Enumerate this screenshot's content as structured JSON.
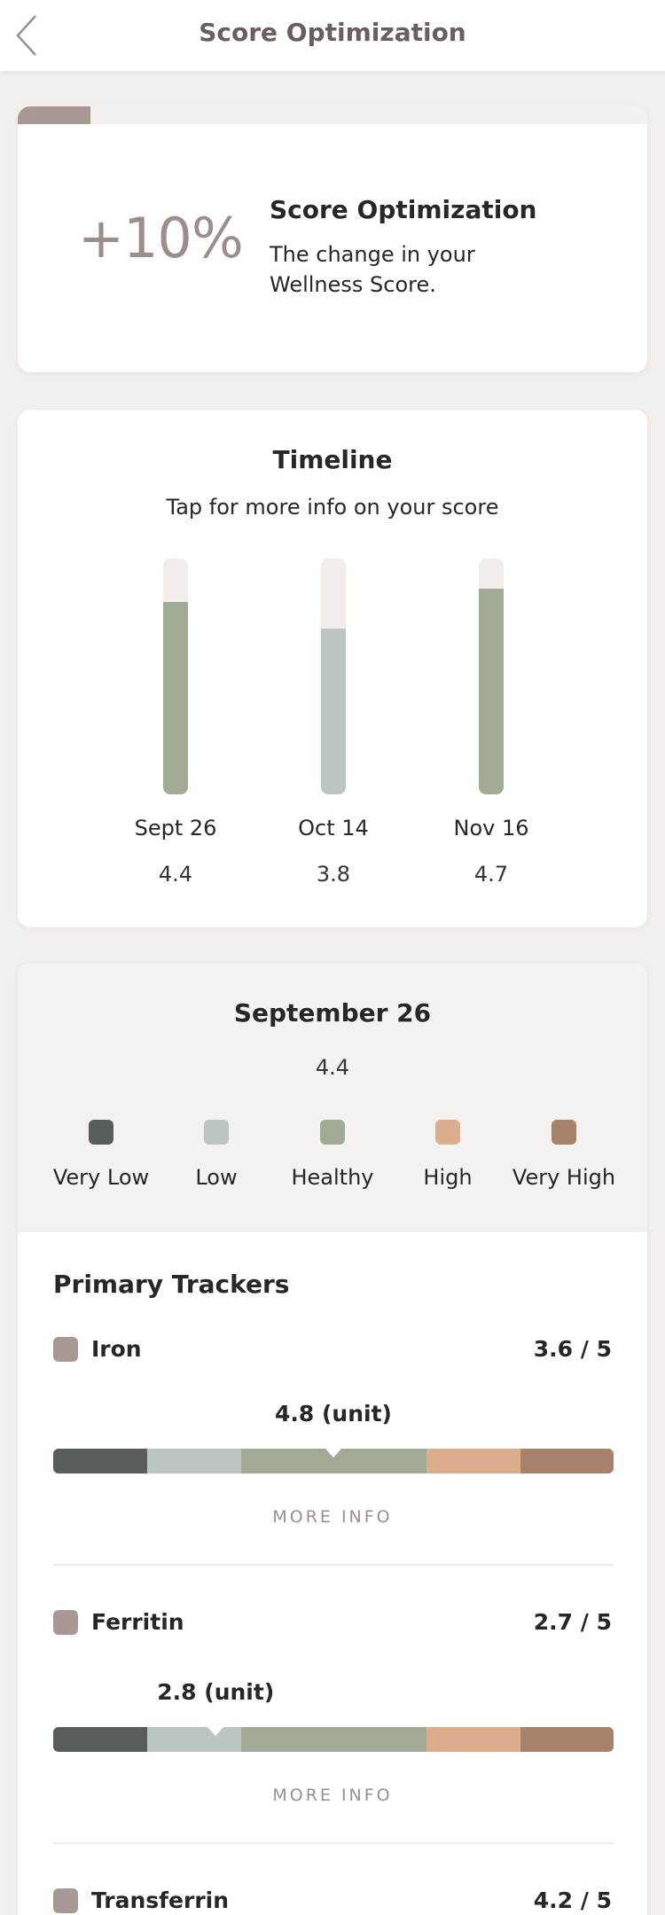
{
  "header": {
    "title": "Score Optimization"
  },
  "score_card": {
    "value": "+10%",
    "title": "Score Optimization",
    "description": "The change in your Wellness Score."
  },
  "timeline": {
    "title": "Timeline",
    "subtitle": "Tap for more info on your score",
    "entries": [
      {
        "date": "Sept 26",
        "score": "4.4",
        "score_value": 4.4,
        "color": "#a0aa95"
      },
      {
        "date": "Oct 14",
        "score": "3.8",
        "score_value": 3.8,
        "color": "#bcc6c0"
      },
      {
        "date": "Nov 16",
        "score": "4.7",
        "score_value": 4.7,
        "color": "#a0aa95"
      }
    ],
    "max": 5.4
  },
  "detail": {
    "title": "September 26",
    "score": "4.4",
    "legend": [
      {
        "label": "Very Low",
        "color": "#575e58"
      },
      {
        "label": "Low",
        "color": "#bcc6c0"
      },
      {
        "label": "Healthy",
        "color": "#a0aa95"
      },
      {
        "label": "High",
        "color": "#dcae8e"
      },
      {
        "label": "Very High",
        "color": "#a6826b"
      }
    ]
  },
  "primary_trackers": {
    "title": "Primary Trackers",
    "more_info_label": "MORE INFO",
    "items": [
      {
        "name": "Iron",
        "value": "3.6 / 5",
        "reading": "4.8 (unit)",
        "pointer_fraction": 0.5
      },
      {
        "name": "Ferritin",
        "value": "2.7 / 5",
        "reading": "2.8 (unit)",
        "pointer_fraction": 0.29
      },
      {
        "name": "Transferrin",
        "value": "4.2 / 5"
      }
    ]
  },
  "range_segments": [
    {
      "label": "Very Low",
      "fraction": 0.168,
      "color": "#575e58"
    },
    {
      "label": "Low",
      "fraction": 0.168,
      "color": "#bcc6c0"
    },
    {
      "label": "Healthy",
      "fraction": 0.33,
      "color": "#a0aa95"
    },
    {
      "label": "High",
      "fraction": 0.168,
      "color": "#dcae8e"
    },
    {
      "label": "Very High",
      "fraction": 0.166,
      "color": "#a6826b"
    }
  ]
}
